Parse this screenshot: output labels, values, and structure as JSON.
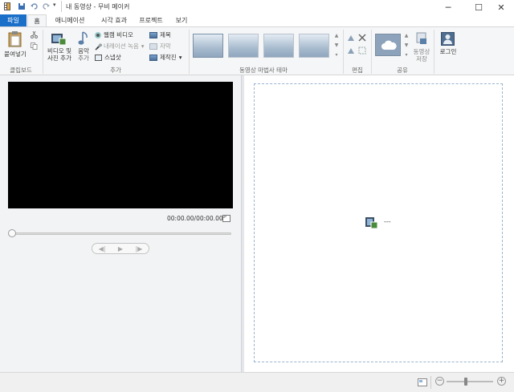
{
  "window": {
    "title": "내 동영상 - 무비 메이커",
    "controls": {
      "minimize": "─",
      "maximize": "☐",
      "close": "✕"
    }
  },
  "tabs": [
    {
      "label": "파일"
    },
    {
      "label": "홈"
    },
    {
      "label": "애니메이션"
    },
    {
      "label": "시각 효과"
    },
    {
      "label": "프로젝트"
    },
    {
      "label": "보기"
    }
  ],
  "ribbon": {
    "clipboard": {
      "group_label": "클립보드",
      "paste_label": "붙여넣기"
    },
    "add": {
      "group_label": "추가",
      "add_media_label_1": "비디오 및",
      "add_media_label_2": "사진 추가",
      "add_music_label_1": "음악",
      "add_music_label_2": "추가",
      "webcam_label": "웹캠 비디오",
      "narration_label": "내레이션 녹음",
      "snapshot_label": "스냅샷",
      "title_label": "제목",
      "caption_label": "자막",
      "credits_label": "제작진"
    },
    "themes": {
      "group_label": "동영상 마법사 테마"
    },
    "edit": {
      "group_label": "편집"
    },
    "share": {
      "group_label": "공유",
      "save_label_1": "동영상",
      "save_label_2": "저장"
    },
    "signin": {
      "label": "로그인"
    }
  },
  "preview": {
    "time": "00:00.00/00:00.00"
  },
  "storyboard": {
    "placeholder_text": "---"
  },
  "colors": {
    "accent": "#1a6fc9",
    "video_bg": "#000000"
  }
}
